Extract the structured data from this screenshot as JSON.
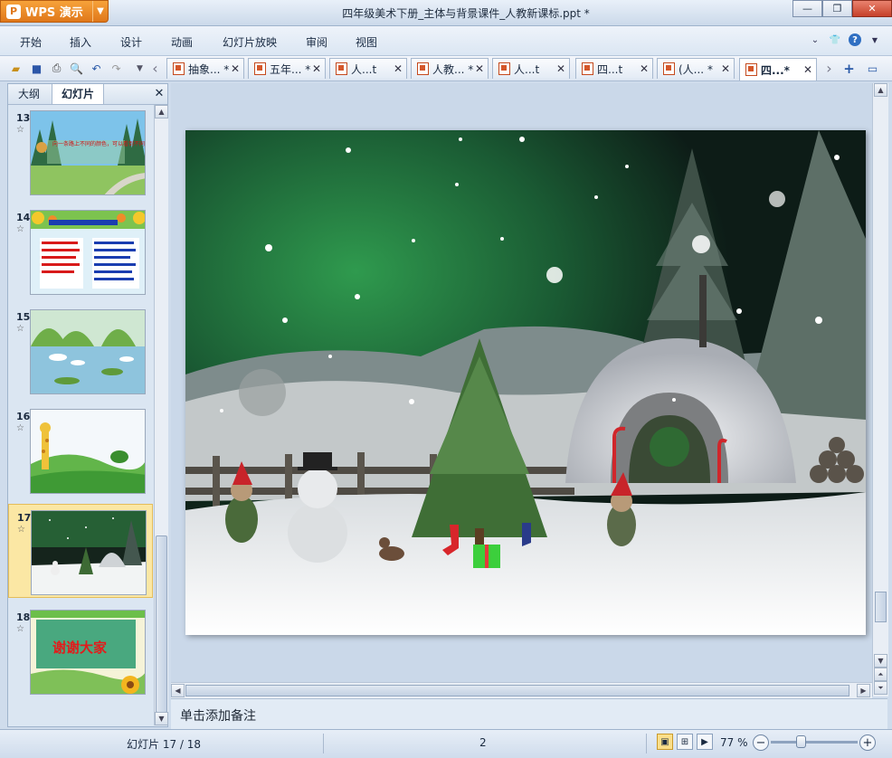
{
  "app": {
    "name": "WPS 演示",
    "logo_glyph": "P"
  },
  "window": {
    "title": "四年级美术下册_主体与背景课件_人教新课标.ppt *"
  },
  "menu": {
    "items": [
      "开始",
      "插入",
      "设计",
      "动画",
      "幻灯片放映",
      "审阅",
      "视图"
    ]
  },
  "tabs": [
    {
      "label": "抽象... *"
    },
    {
      "label": "五年... *"
    },
    {
      "label": "人...t"
    },
    {
      "label": "人教... *"
    },
    {
      "label": "人...t"
    },
    {
      "label": "四...t"
    },
    {
      "label": "(人... *"
    },
    {
      "label": "四...*"
    }
  ],
  "active_tab_index": 7,
  "left_panel": {
    "tabs": [
      "大纲",
      "幻灯片"
    ],
    "close_glyph": "✕",
    "slides": [
      {
        "number": "13",
        "text": "向一条路上不同的颜色，可以看到不同的花朵颜色。"
      },
      {
        "number": "14",
        "text": ""
      },
      {
        "number": "15",
        "text": ""
      },
      {
        "number": "16",
        "text": ""
      },
      {
        "number": "17",
        "text": ""
      },
      {
        "number": "18",
        "text": "谢谢大家"
      }
    ],
    "selected_slide": "17"
  },
  "notes": {
    "placeholder": "单击添加备注"
  },
  "status": {
    "slide_info": "幻灯片 17 / 18",
    "center_value": "2",
    "zoom": "77 %"
  },
  "zoom_level": 0.77,
  "colors": {
    "accent": "#e0771a",
    "selection": "#fbe7a4",
    "close_button": "#c6402a"
  }
}
